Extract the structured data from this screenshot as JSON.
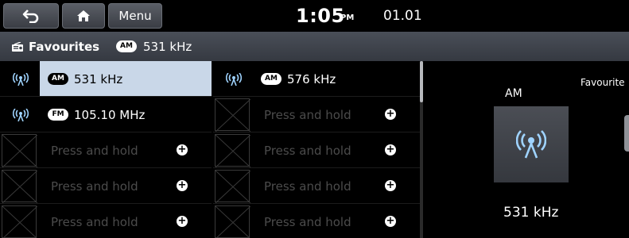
{
  "top_bar": {
    "menu_label": "Menu",
    "time": "1:05",
    "ampm": "PM",
    "date": "01.01"
  },
  "title_bar": {
    "title": "Favourites",
    "band_badge": "AM",
    "frequency": "531 kHz"
  },
  "favourites_left": [
    {
      "badge": "AM",
      "label": "531 kHz",
      "state": "selected"
    },
    {
      "badge": "FM",
      "label": "105.10 MHz",
      "state": "filled"
    },
    {
      "badge": "",
      "label": "Press and hold",
      "state": "empty"
    },
    {
      "badge": "",
      "label": "Press and hold",
      "state": "empty"
    },
    {
      "badge": "",
      "label": "Press and hold",
      "state": "empty"
    }
  ],
  "favourites_right": [
    {
      "badge": "AM",
      "label": "576 kHz",
      "state": "filled"
    },
    {
      "badge": "",
      "label": "Press and hold",
      "state": "empty"
    },
    {
      "badge": "",
      "label": "Press and hold",
      "state": "empty"
    },
    {
      "badge": "",
      "label": "Press and hold",
      "state": "empty"
    },
    {
      "badge": "",
      "label": "Press and hold",
      "state": "empty"
    }
  ],
  "now_playing": {
    "band": "AM",
    "favourites_label": "Favourite",
    "frequency": "531 kHz"
  },
  "icons": {
    "back": "back-arrow-icon",
    "home": "home-icon",
    "radio": "radio-icon",
    "wave": "radio-wave-icon",
    "add": "plus-icon"
  },
  "colors": {
    "selected_row": "#c9d7e8",
    "empty_text": "#4b4b4b",
    "title_bar": "#3e424a"
  }
}
